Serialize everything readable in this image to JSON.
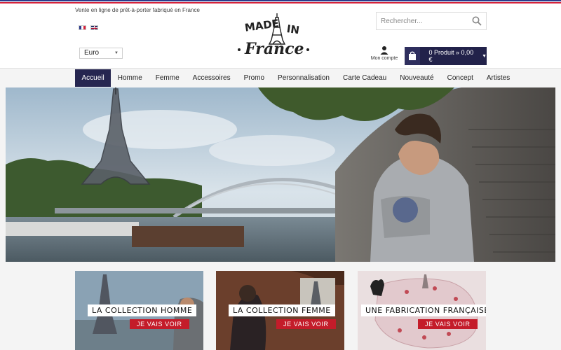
{
  "colors": {
    "flag_blue": "#2b3a8c",
    "flag_white": "#ffffff",
    "flag_red": "#d5213a",
    "nav_active": "#262650",
    "cart_bg": "#22224a",
    "cta_red": "#c41c2a"
  },
  "header": {
    "tagline": "Vente en ligne de prêt-à-porter fabriqué en France",
    "languages": [
      "fr",
      "en"
    ],
    "currency": "Euro",
    "logo": {
      "line1": "MADE",
      "line2": "IN",
      "line3": "France"
    },
    "search": {
      "placeholder": "Rechercher..."
    },
    "account_label": "Mon compte",
    "cart_label": "0 Produit » 0,00 €"
  },
  "nav": {
    "items": [
      "Accueil",
      "Homme",
      "Femme",
      "Accessoires",
      "Promo",
      "Personnalisation",
      "Carte Cadeau",
      "Nouveauté",
      "Concept",
      "Artistes"
    ],
    "active": "Accueil"
  },
  "tiles": [
    {
      "title": "LA COLLECTION HOMME",
      "cta": "JE VAIS VOIR"
    },
    {
      "title": "LA COLLECTION FEMME",
      "cta": "JE VAIS VOIR"
    },
    {
      "title": "UNE FABRICATION FRANÇAISE !",
      "cta": "JE VAIS VOIR"
    }
  ],
  "icons": {
    "search": "search-icon",
    "account": "user-icon",
    "cart": "shopping-bag-icon",
    "currency_dropdown": "chevron-down-icon",
    "cart_dropdown": "chevron-down-icon"
  }
}
